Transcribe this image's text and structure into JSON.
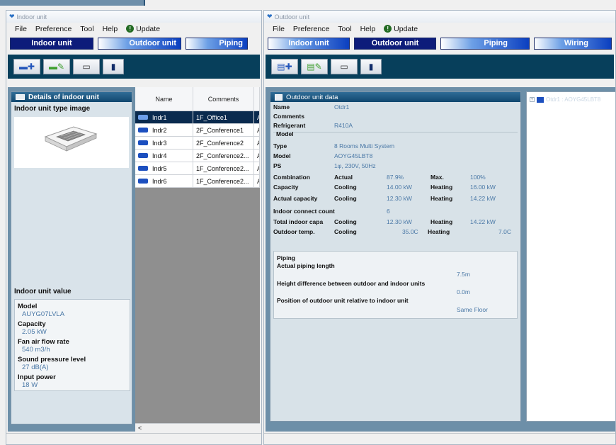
{
  "indoor_window": {
    "title": "Indoor unit",
    "menu": [
      "File",
      "Preference",
      "Tool",
      "Help"
    ],
    "update_label": "Update",
    "tabs": [
      "Indoor unit",
      "Outdoor unit",
      "Piping"
    ],
    "details_title": "Details of indoor unit",
    "type_image_label": "Indoor unit type image",
    "unit_value_label": "Indoor unit value",
    "values": {
      "model_label": "Model",
      "model": "AUYG07LVLA",
      "capacity_label": "Capacity",
      "capacity": "2.05 kW",
      "airflow_label": "Fan air flow rate",
      "airflow": "540 m3/h",
      "sound_label": "Sound pressure level",
      "sound": "27 dB(A)",
      "power_label": "Input power",
      "power": "18 W"
    },
    "table": {
      "headers": [
        "Name",
        "Comments"
      ],
      "rows": [
        {
          "name": "Indr1",
          "comment": "1F_Office1",
          "extra": "Al"
        },
        {
          "name": "Indr2",
          "comment": "2F_Conference1",
          "extra": "Al"
        },
        {
          "name": "Indr3",
          "comment": "2F_Conference2",
          "extra": "Al"
        },
        {
          "name": "Indr4",
          "comment": "2F_Conference2...",
          "extra": "Al"
        },
        {
          "name": "Indr5",
          "comment": "1F_Conference2...",
          "extra": "Al"
        },
        {
          "name": "Indr6",
          "comment": "1F_Conference2...",
          "extra": "Al"
        }
      ],
      "scroll_left": "<"
    }
  },
  "outdoor_window": {
    "title": "Outdoor unit",
    "menu": [
      "File",
      "Preference",
      "Tool",
      "Help"
    ],
    "update_label": "Update",
    "tabs": [
      "Indoor unit",
      "Outdoor unit",
      "Piping",
      "Wiring"
    ],
    "data_title": "Outdoor unit data",
    "name_label": "Name",
    "name": "Otdr1",
    "comments_label": "Comments",
    "refrigerant_label": "Refrigerant",
    "refrigerant": "R410A",
    "model_section": "Model",
    "type_label": "Type",
    "type": "8 Rooms Multi System",
    "model_label": "Model",
    "model": "AOYG45LBT8",
    "ps_label": "PS",
    "ps": "1φ, 230V, 50Hz",
    "combination_label": "Combination",
    "actual_label": "Actual",
    "combination_actual": "87.9%",
    "max_label": "Max.",
    "combination_max": "100%",
    "capacity_label": "Capacity",
    "cooling_label": "Cooling",
    "capacity_cooling": "14.00 kW",
    "heating_label": "Heating",
    "capacity_heating": "16.00 kW",
    "actual_capacity_label": "Actual capacity",
    "actual_capacity_cooling": "12.30 kW",
    "actual_capacity_heating": "14.22 kW",
    "indoor_count_label": "Indoor connect count",
    "indoor_count": "6",
    "total_indoor_label": "Total indoor capa",
    "total_indoor_cooling": "12.30 kW",
    "total_indoor_heating": "14.22 kW",
    "outdoor_temp_label": "Outdoor temp.",
    "outdoor_temp_cooling": "35.0C",
    "outdoor_temp_heating": "7.0C",
    "piping_section": "Piping",
    "piping_length_label": "Actual piping length",
    "piping_length": "7.5m",
    "height_diff_label": "Height difference between outdoor and indoor units",
    "height_diff": "0.0m",
    "position_label": "Position of outdoor unit relative to indoor unit",
    "position": "Same Floor",
    "tree_item": "Otdr1 : AOYG45LBT8"
  }
}
